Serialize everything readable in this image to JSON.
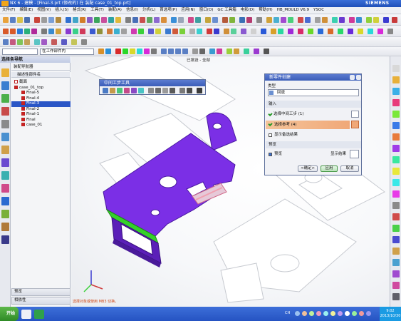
{
  "app": {
    "title": "NX 6 - 建模 - [Final-3.prt (修改的) 在 装配 case_01_top.prt]",
    "brand": "SIEMENS"
  },
  "menu": [
    "文件(F)",
    "编辑(E)",
    "视图(V)",
    "插入(S)",
    "格式(R)",
    "工具(T)",
    "装配(A)",
    "信息(I)",
    "分析(L)",
    "首选项(P)",
    "应用(N)",
    "窗口(O)",
    "GC 工具箱",
    "电影(D)",
    "帮助(H)",
    "HB_MOULD V6.9",
    "YSOC"
  ],
  "toolbar": {
    "filter_value": "",
    "assembly_filter": "在工作部件内",
    "sheet_label": "已填设 - 全部"
  },
  "navigator": {
    "title": "选择条导航",
    "section_title": "装配导航器",
    "column_header": "描述性部件名",
    "items": [
      {
        "label": "截面",
        "indent": 0,
        "checked": false,
        "selected": false
      },
      {
        "label": "case_01_top",
        "indent": 0,
        "checked": true,
        "selected": false
      },
      {
        "label": "Final-5",
        "indent": 1,
        "checked": true,
        "selected": false
      },
      {
        "label": "Final-4",
        "indent": 1,
        "checked": true,
        "selected": false
      },
      {
        "label": "Final-3",
        "indent": 1,
        "checked": true,
        "selected": true
      },
      {
        "label": "Final-2",
        "indent": 1,
        "checked": true,
        "selected": false
      },
      {
        "label": "Final-1",
        "indent": 1,
        "checked": true,
        "selected": false
      },
      {
        "label": "Final",
        "indent": 1,
        "checked": true,
        "selected": false
      },
      {
        "label": "case_01",
        "indent": 1,
        "checked": true,
        "selected": false
      }
    ],
    "bottom": [
      "预览",
      "相依性"
    ]
  },
  "floating_toolbar": {
    "title": "中间工步工具"
  },
  "dialog": {
    "title": "新零件创建",
    "type_section": "类型",
    "type_value": "回退",
    "input_section": "输入",
    "select_intermediate": "选择中间工步 (1)",
    "select_reference": "选择参考 (4)",
    "show_alt": "显示备选结果",
    "preview_section": "预览",
    "preview_check": "预览",
    "show_result": "显示结果",
    "ok": "<确定>",
    "apply": "应用",
    "cancel": "取消"
  },
  "status": {
    "bottom_hint": "选择对象或使用 MB3 切换。",
    "clock_time": "9:02",
    "clock_date": "2013/10/30"
  },
  "taskbar": {
    "start": "开始",
    "lang": "CH"
  },
  "colors": {
    "part_main": "#7b2fe6",
    "part_edge": "#5b1fb8",
    "highlight_face": "#35d12a",
    "background": "#ffffff",
    "dialog_header": "#3b5db8"
  }
}
